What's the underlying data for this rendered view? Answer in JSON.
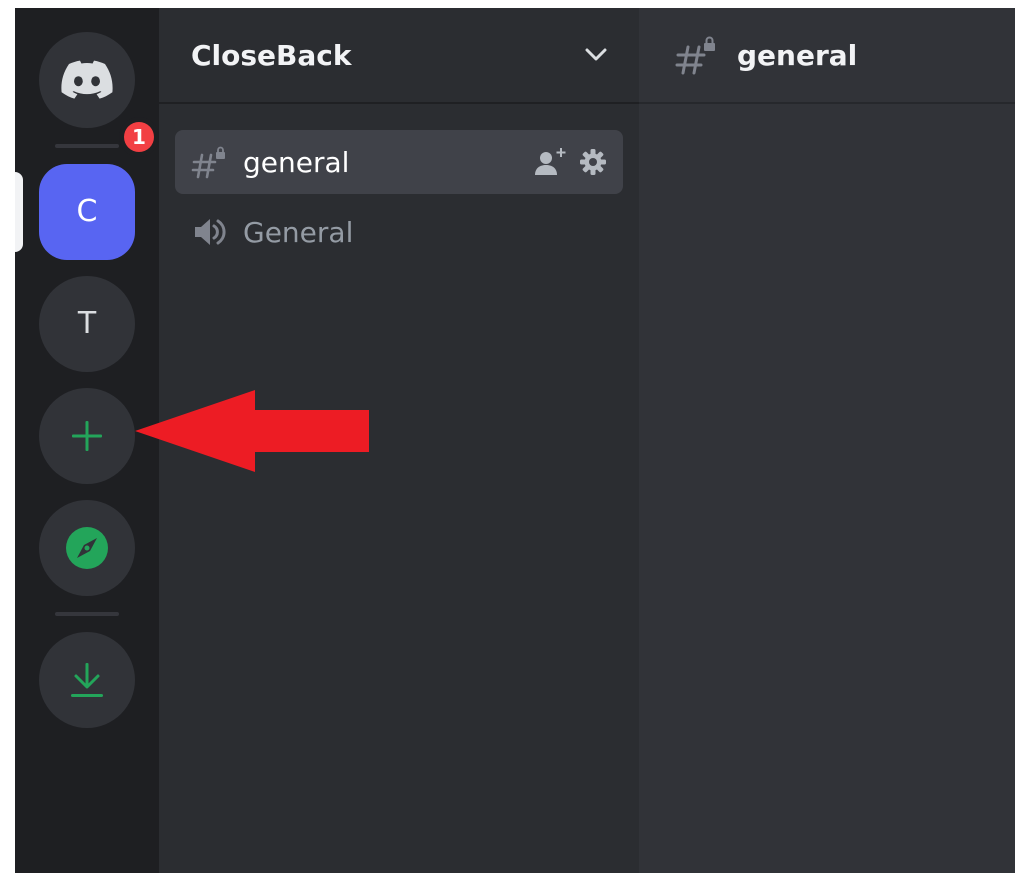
{
  "servers": {
    "home_badge_count": "1",
    "items": [
      {
        "letter": "C",
        "selected": true
      },
      {
        "letter": "T",
        "selected": false
      }
    ]
  },
  "guild": {
    "name": "CloseBack"
  },
  "channels": [
    {
      "type": "text",
      "name": "general",
      "locked": true,
      "active": true
    },
    {
      "type": "voice",
      "name": "General",
      "locked": false,
      "active": false
    }
  ],
  "main": {
    "channel_title": "general"
  },
  "colors": {
    "accent": "#5865f2",
    "green": "#23a55a",
    "badge_red": "#f23f43",
    "annotation_red": "#ed1c24"
  },
  "icons": {
    "home": "discord-logo-icon",
    "add": "plus-icon",
    "explore": "compass-icon",
    "download": "download-icon",
    "dropdown": "chevron-down-icon",
    "text_channel": "hashtag-lock-icon",
    "voice_channel": "speaker-icon",
    "invite": "add-member-icon",
    "settings": "gear-icon"
  }
}
